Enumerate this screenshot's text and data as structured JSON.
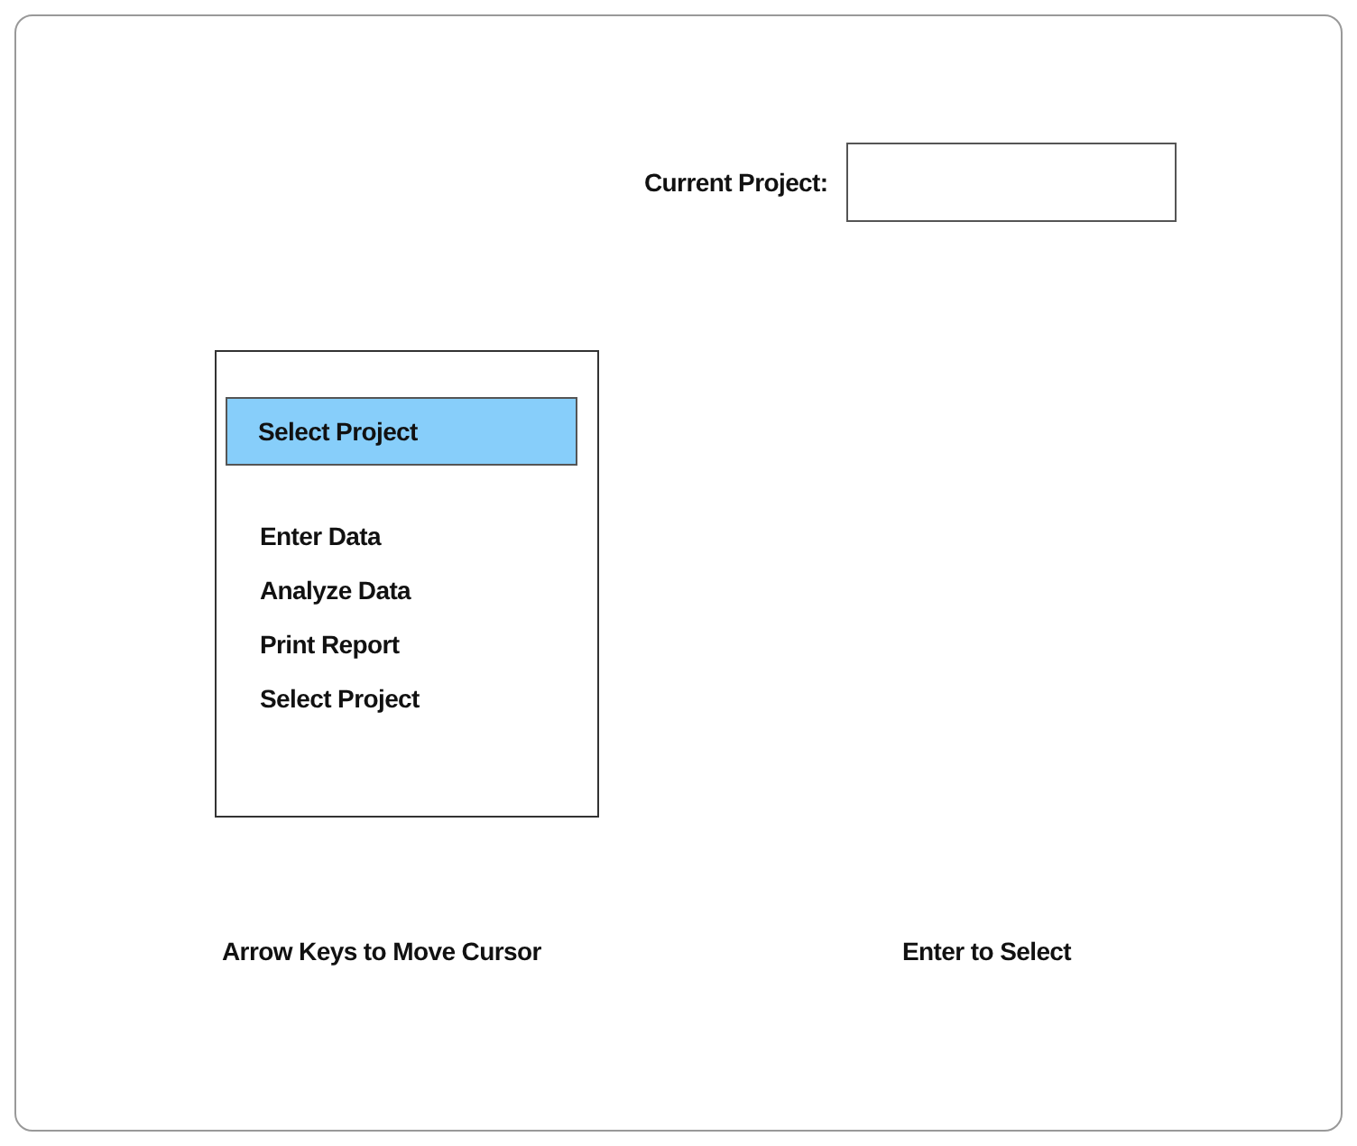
{
  "current_project": {
    "label": "Current Project:"
  },
  "menu": {
    "items": [
      {
        "label": "Select Project",
        "selected": true
      },
      {
        "label": "Enter Data",
        "selected": false
      },
      {
        "label": "Analyze Data",
        "selected": false
      },
      {
        "label": "Print Report",
        "selected": false
      },
      {
        "label": "Select Project",
        "selected": false
      }
    ]
  },
  "hints": [
    "Arrow Keys to Move Cursor",
    "Enter to Select"
  ]
}
